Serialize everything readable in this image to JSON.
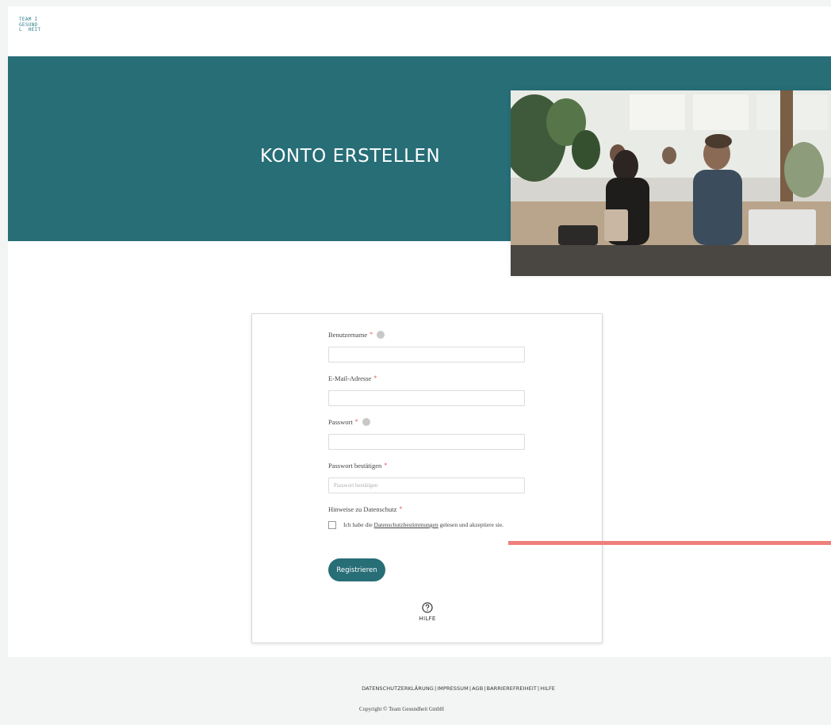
{
  "logo": {
    "text": "TEAM I\nGESUND\nL  HEIT"
  },
  "hero": {
    "title": "KONTO ERSTELLEN",
    "photo_name": "office-team-photo"
  },
  "form": {
    "username_label": "Benutzername",
    "email_label": "E-Mail-Adresse",
    "password_label": "Passwort",
    "password_confirm_label": "Passwort bestätigen",
    "password_confirm_placeholder": "Passwort bestätigen",
    "privacy_label": "Hinweise zu Datenschutz",
    "required_mark": "*",
    "consent_prefix": "Ich habe die ",
    "consent_link": "Datenschutzbestimmungen",
    "consent_suffix": " gelesen und akzeptiere sie.",
    "submit_label": "Registrieren"
  },
  "help": {
    "label": "HILFE",
    "icon": "question-circle-icon"
  },
  "footer": {
    "links": [
      "DATENSCHUTZERKLÄRUNG",
      "IMPRESSUM",
      "AGB",
      "BARRIEREFREIHEIT",
      "HILFE"
    ],
    "separator": "|",
    "copyright": "Copyright © Team Gesundheit GmbH"
  },
  "colors": {
    "brand": "#276e77",
    "accent_line": "#ef7f7b",
    "footer_bg": "#f3f5f5"
  }
}
